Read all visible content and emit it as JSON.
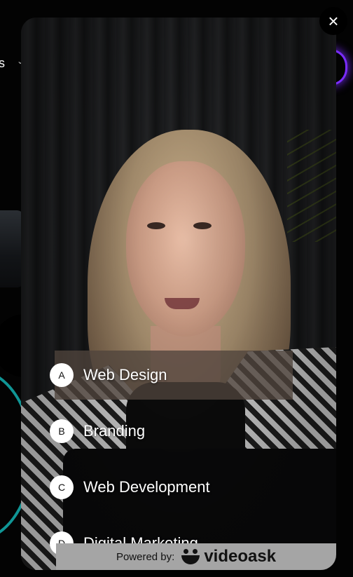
{
  "background": {
    "nav_text": "s",
    "nav_chevron": "⌄"
  },
  "modal": {
    "close_icon": "×",
    "choices": [
      {
        "letter": "A",
        "label": "Web Design"
      },
      {
        "letter": "B",
        "label": "Branding"
      },
      {
        "letter": "C",
        "label": "Web Development"
      },
      {
        "letter": "D",
        "label": "Digital Marketing"
      }
    ],
    "footer": {
      "powered_by": "Powered by:",
      "brand": "videoask"
    }
  },
  "colors": {
    "accent_purple": "#7a2cff",
    "accent_teal": "#16c7c7",
    "footer_bg": "#a5a5a5"
  }
}
